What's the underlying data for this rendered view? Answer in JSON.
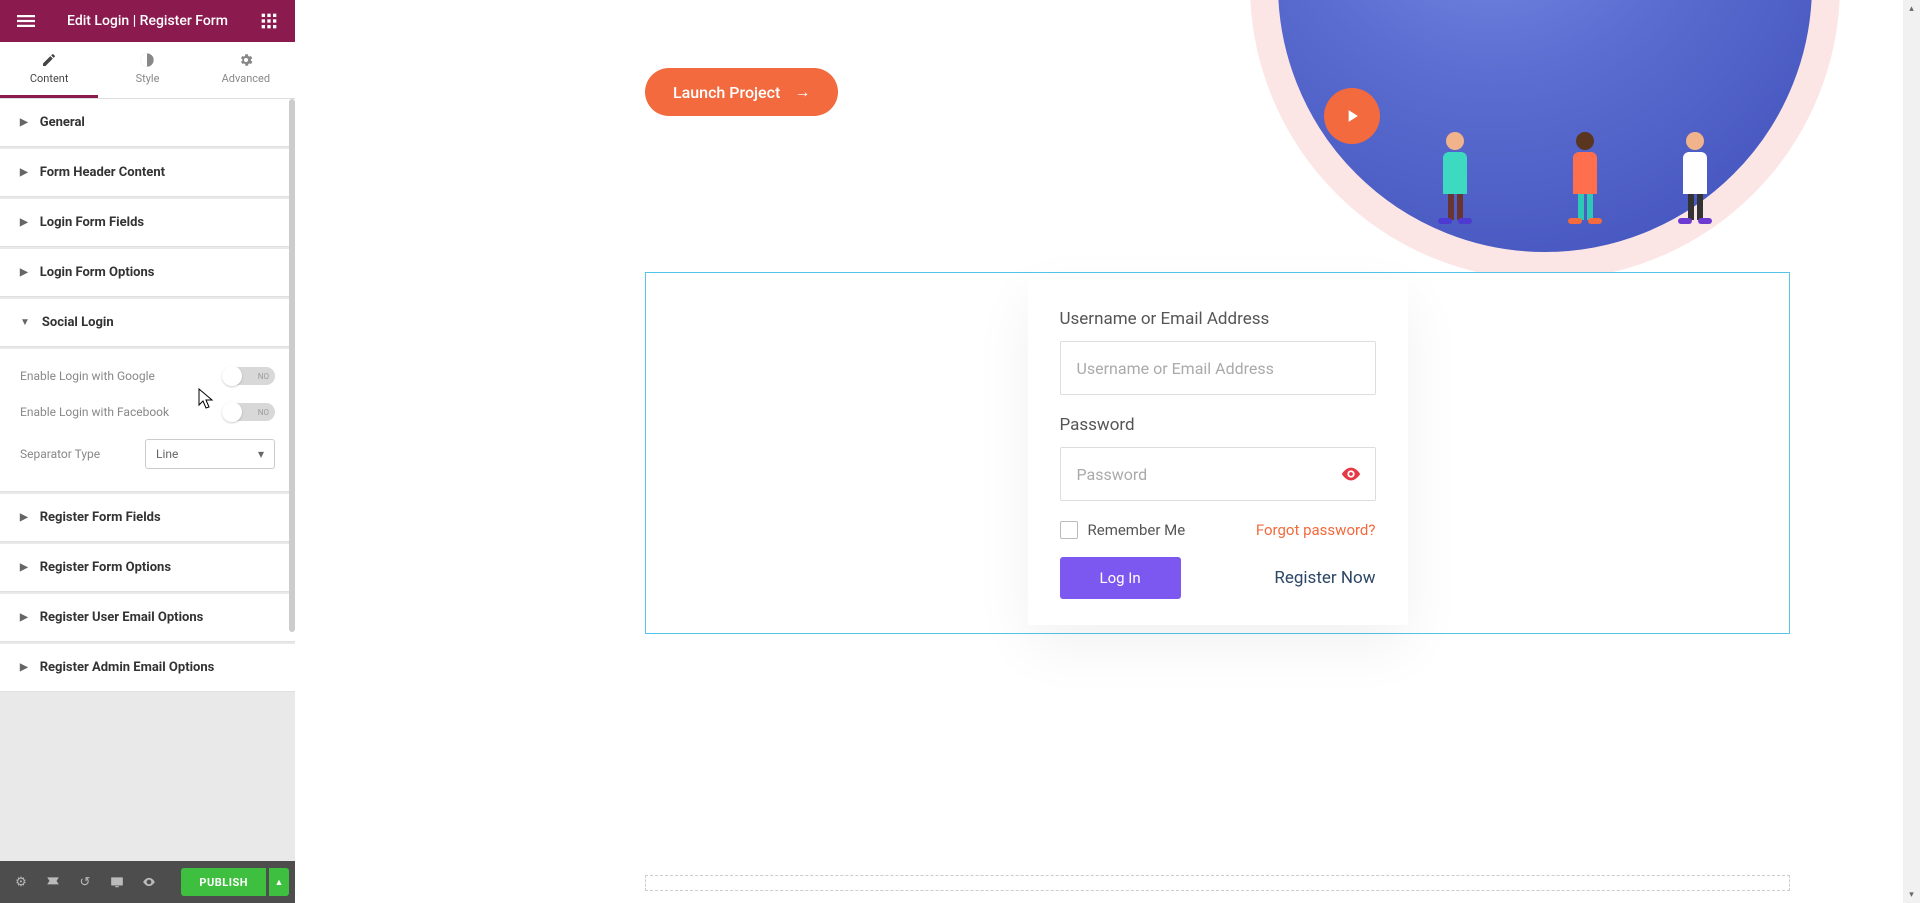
{
  "header": {
    "title": "Edit Login | Register Form"
  },
  "tabs": {
    "content": "Content",
    "style": "Style",
    "advanced": "Advanced"
  },
  "sections": {
    "general": "General",
    "form_header": "Form Header Content",
    "login_fields": "Login Form Fields",
    "login_options": "Login Form Options",
    "social_login": "Social Login",
    "register_fields": "Register Form Fields",
    "register_options": "Register Form Options",
    "register_user_email": "Register User Email Options",
    "register_admin_email": "Register Admin Email Options"
  },
  "social": {
    "google_label": "Enable Login with Google",
    "google_state": "NO",
    "facebook_label": "Enable Login with Facebook",
    "facebook_state": "NO",
    "separator_label": "Separator Type",
    "separator_value": "Line"
  },
  "publish": {
    "label": "PUBLISH"
  },
  "canvas": {
    "launch": "Launch Project",
    "form": {
      "username_label": "Username or Email Address",
      "username_placeholder": "Username or Email Address",
      "password_label": "Password",
      "password_placeholder": "Password",
      "remember": "Remember Me",
      "forgot": "Forgot password?",
      "login": "Log In",
      "register": "Register Now"
    }
  }
}
